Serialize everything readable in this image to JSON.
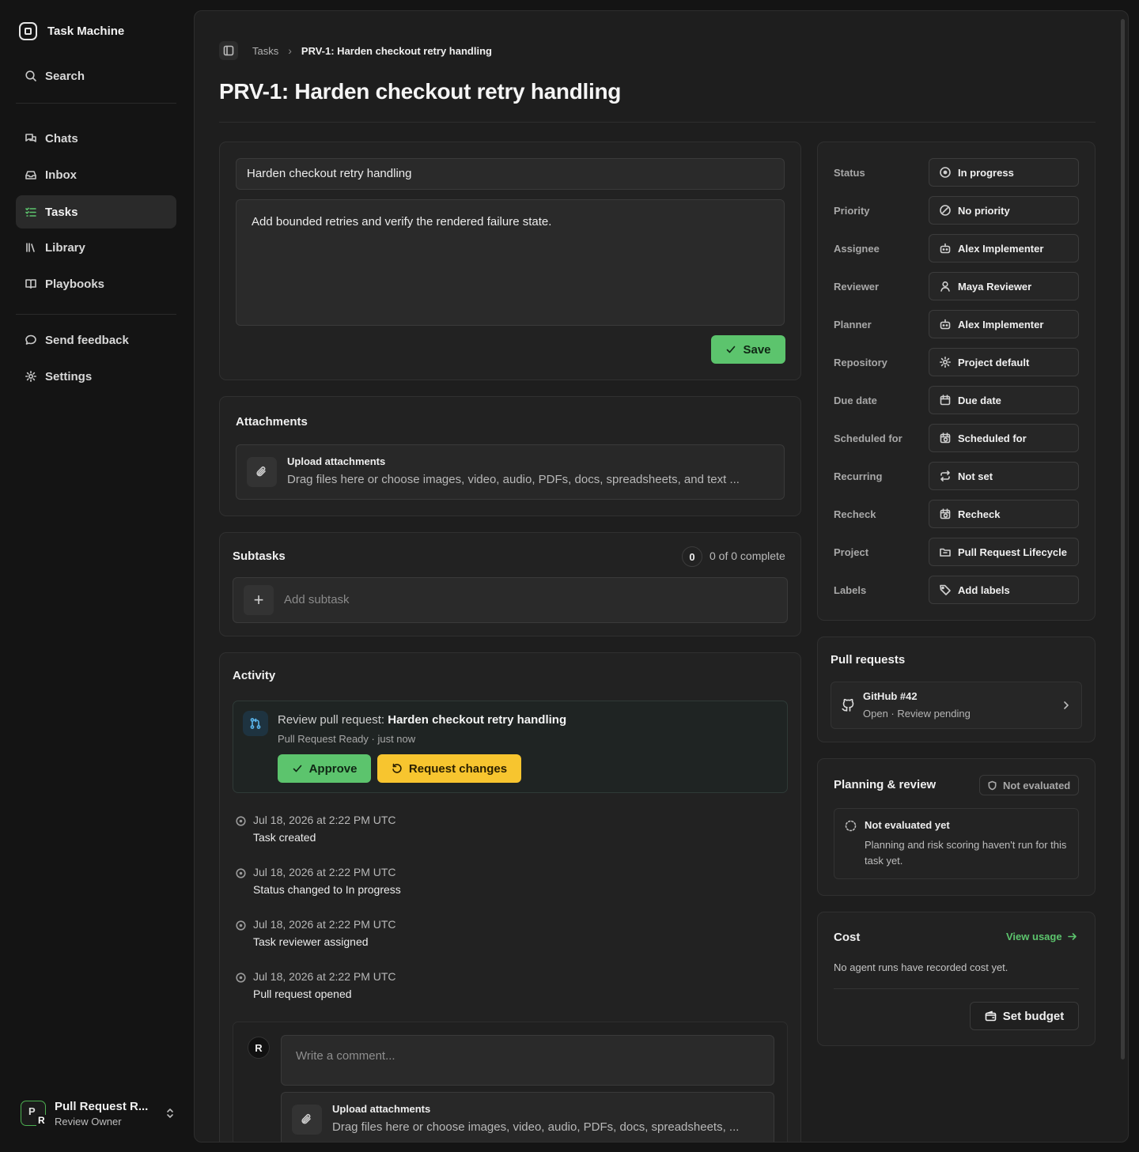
{
  "app": {
    "name": "Task Machine"
  },
  "sidebar": {
    "search_label": "Search",
    "nav": [
      {
        "label": "Chats",
        "icon": "chats-icon"
      },
      {
        "label": "Inbox",
        "icon": "inbox-icon"
      },
      {
        "label": "Tasks",
        "icon": "tasks-icon",
        "active": true
      },
      {
        "label": "Library",
        "icon": "library-icon"
      },
      {
        "label": "Playbooks",
        "icon": "playbooks-icon"
      }
    ],
    "footer": [
      {
        "label": "Send feedback",
        "icon": "feedback-icon"
      },
      {
        "label": "Settings",
        "icon": "gear-icon"
      }
    ],
    "user": {
      "avatar_primary": "P",
      "avatar_secondary": "R",
      "name": "Pull Request R...",
      "role": "Review Owner"
    }
  },
  "breadcrumb": {
    "parent": "Tasks",
    "separator": "›",
    "current": "PRV-1: Harden checkout retry handling"
  },
  "page_title": "PRV-1: Harden checkout retry handling",
  "editor": {
    "title_value": "Harden checkout retry handling",
    "description_value": "Add bounded retries and verify the rendered failure state.",
    "save_label": "Save"
  },
  "attachments": {
    "title": "Attachments",
    "upload_title": "Upload attachments",
    "upload_hint": "Drag files here or choose images, video, audio, PDFs, docs, spreadsheets, and text ..."
  },
  "subtasks": {
    "title": "Subtasks",
    "count": "0",
    "progress_text": "0 of 0 complete",
    "add_placeholder": "Add subtask",
    "add_symbol": "+"
  },
  "activity": {
    "title": "Activity",
    "review": {
      "prefix": "Review pull request: ",
      "task": "Harden checkout retry handling",
      "meta": "Pull Request Ready · just now",
      "approve_label": "Approve",
      "request_changes_label": "Request changes"
    },
    "events": [
      {
        "time": "Jul 18, 2026 at 2:22 PM UTC",
        "text": "Task created"
      },
      {
        "time": "Jul 18, 2026 at 2:22 PM UTC",
        "text": "Status changed to In progress"
      },
      {
        "time": "Jul 18, 2026 at 2:22 PM UTC",
        "text": "Task reviewer assigned"
      },
      {
        "time": "Jul 18, 2026 at 2:22 PM UTC",
        "text": "Pull request opened"
      }
    ],
    "comment": {
      "avatar": "R",
      "placeholder": "Write a comment...",
      "upload_title": "Upload attachments",
      "upload_hint": "Drag files here or choose images, video, audio, PDFs, docs, spreadsheets, ..."
    }
  },
  "properties": [
    {
      "label": "Status",
      "value": "In progress",
      "icon": "status-icon"
    },
    {
      "label": "Priority",
      "value": "No priority",
      "icon": "priority-icon"
    },
    {
      "label": "Assignee",
      "value": "Alex Implementer",
      "icon": "bot-icon"
    },
    {
      "label": "Reviewer",
      "value": "Maya Reviewer",
      "icon": "user-icon"
    },
    {
      "label": "Planner",
      "value": "Alex Implementer",
      "icon": "bot-icon"
    },
    {
      "label": "Repository",
      "value": "Project default",
      "icon": "gear-icon"
    },
    {
      "label": "Due date",
      "value": "Due date",
      "icon": "calendar-icon"
    },
    {
      "label": "Scheduled for",
      "value": "Scheduled for",
      "icon": "calendar-clock-icon"
    },
    {
      "label": "Recurring",
      "value": "Not set",
      "icon": "repeat-icon"
    },
    {
      "label": "Recheck",
      "value": "Recheck",
      "icon": "calendar-clock-icon"
    },
    {
      "label": "Project",
      "value": "Pull Request Lifecycle",
      "icon": "folder-icon"
    },
    {
      "label": "Labels",
      "value": "Add labels",
      "icon": "tag-icon"
    }
  ],
  "pull_requests": {
    "title": "Pull requests",
    "items": [
      {
        "name": "GitHub #42",
        "status": "Open · Review pending"
      }
    ]
  },
  "planning": {
    "title": "Planning & review",
    "badge": "Not evaluated",
    "state_title": "Not evaluated yet",
    "state_desc": "Planning and risk scoring haven't run for this task yet."
  },
  "cost": {
    "title": "Cost",
    "view_usage": "View usage",
    "empty_text": "No agent runs have recorded cost yet.",
    "budget_label": "Set budget"
  },
  "colors": {
    "accent_green": "#5cc46d",
    "warning_yellow": "#f7c52f",
    "pr_blue": "#5ab4ea"
  }
}
